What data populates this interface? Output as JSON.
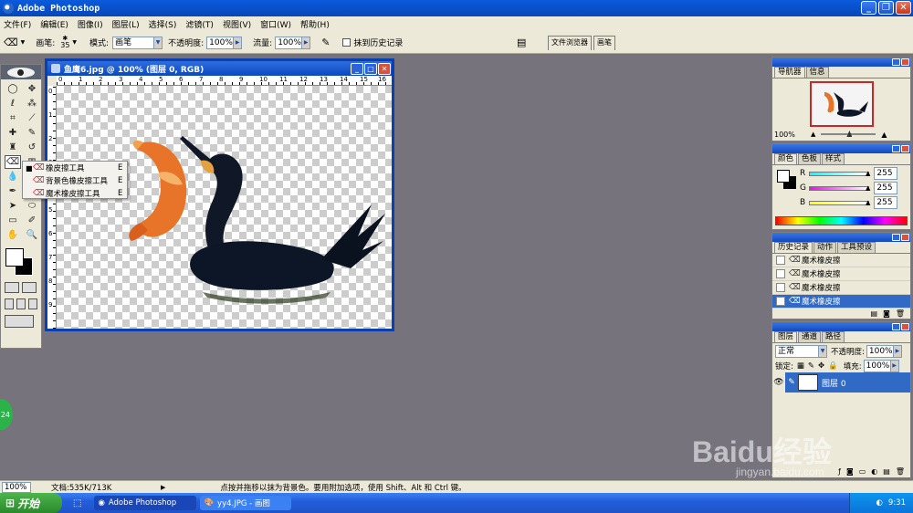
{
  "app": {
    "title": "Adobe Photoshop"
  },
  "window_buttons": {
    "min": "_",
    "max": "❐",
    "close": "✕"
  },
  "menu": [
    "文件(F)",
    "编辑(E)",
    "图像(I)",
    "图层(L)",
    "选择(S)",
    "滤镜(T)",
    "视图(V)",
    "窗口(W)",
    "帮助(H)"
  ],
  "options": {
    "brush_label": "画笔:",
    "brush_size": "35",
    "mode_label": "模式:",
    "mode_value": "画笔",
    "opacity_label": "不透明度:",
    "opacity_value": "100%",
    "flow_label": "流量:",
    "flow_value": "100%",
    "erase_history_label": "抹到历史记录",
    "well_tabs": [
      "文件浏览器",
      "画笔"
    ]
  },
  "flyout": {
    "items": [
      {
        "label": "橡皮擦工具",
        "key": "E",
        "selected": true
      },
      {
        "label": "背景色橡皮擦工具",
        "key": "E",
        "selected": false
      },
      {
        "label": "魔术橡皮擦工具",
        "key": "E",
        "selected": false
      }
    ]
  },
  "document": {
    "title": "鱼鹰6.jpg @ 100% (图层 0, RGB)",
    "ruler_top": [
      "0",
      "1",
      "2",
      "3",
      "4",
      "5",
      "6",
      "7",
      "8",
      "9",
      "10",
      "11",
      "12",
      "13",
      "14",
      "15",
      "16"
    ],
    "ruler_left": [
      "0",
      "1",
      "2",
      "3",
      "4",
      "5",
      "6",
      "7",
      "8",
      "9"
    ]
  },
  "navigator": {
    "tabs": [
      "导航器",
      "信息"
    ],
    "zoom": "100%"
  },
  "color": {
    "tabs": [
      "颜色",
      "色板",
      "样式"
    ],
    "channels": [
      {
        "name": "R",
        "value": "255",
        "color": "#00c0c0"
      },
      {
        "name": "G",
        "value": "255",
        "color": "#c000c0"
      },
      {
        "name": "B",
        "value": "255",
        "color": "#c0c000"
      }
    ]
  },
  "history": {
    "tabs": [
      "历史记录",
      "动作",
      "工具预设"
    ],
    "items": [
      {
        "label": "魔术橡皮擦",
        "selected": false
      },
      {
        "label": "魔术橡皮擦",
        "selected": false
      },
      {
        "label": "魔术橡皮擦",
        "selected": false
      },
      {
        "label": "魔术橡皮擦",
        "selected": true
      }
    ]
  },
  "layers": {
    "tabs": [
      "图层",
      "通道",
      "路径"
    ],
    "blend_mode": "正常",
    "opacity_label": "不透明度:",
    "opacity_value": "100%",
    "lock_label": "锁定:",
    "fill_label": "填充:",
    "fill_value": "100%",
    "layer_name": "图层 0"
  },
  "status": {
    "zoom": "100%",
    "doc_info": "文档:535K/713K",
    "hint": "点按并拖移以抹为背景色。要用附加选项，使用 Shift、Alt 和 Ctrl 键。"
  },
  "taskbar": {
    "start": "开始",
    "tasks": [
      "Adobe Photoshop",
      "yy4.JPG - 画图"
    ],
    "clock": "9:31"
  },
  "watermark": {
    "main": "Baidu经验",
    "sub": "jingyan.baidu.com"
  },
  "badge": "24"
}
